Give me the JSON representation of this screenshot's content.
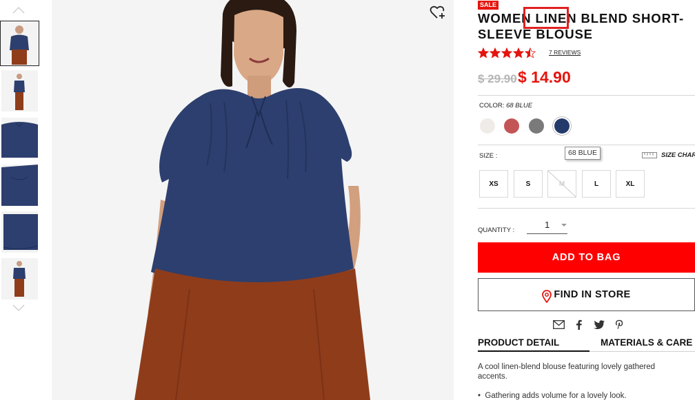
{
  "product": {
    "sale_badge": "SALE",
    "title": "WOMEN LINEN BLEND SHORT-SLEEVE BLOUSE",
    "rating": 4.5,
    "rating_max": 5,
    "reviews_label": "7 REVIEWS",
    "price_old": "$ 29.90",
    "price_new": "$ 14.90"
  },
  "color": {
    "label": "COLOR:",
    "selected_value": "68 BLUE",
    "swatches": [
      {
        "name": "off-white",
        "hex": "#efebe6"
      },
      {
        "name": "red",
        "hex": "#c45556"
      },
      {
        "name": "gray",
        "hex": "#7a7a7a"
      },
      {
        "name": "blue",
        "hex": "#243a6b"
      }
    ],
    "tooltip": "68 BLUE"
  },
  "size": {
    "label": "SIZE :",
    "chart_label": "SIZE CHART",
    "options": [
      "XS",
      "S",
      "M",
      "L",
      "XL"
    ],
    "unavailable": [
      "M"
    ]
  },
  "quantity": {
    "label": "QUANTITY :",
    "value": "1"
  },
  "actions": {
    "add_to_bag": "ADD TO BAG",
    "find_in_store": "FIND IN STORE"
  },
  "share": [
    "mail-icon",
    "facebook-icon",
    "twitter-icon",
    "pinterest-icon"
  ],
  "tabs": {
    "product_detail": "PRODUCT DETAIL",
    "materials": "MATERIALS & CARE"
  },
  "detail": {
    "description": "A cool linen-blend blouse featuring lovely gathered accents.",
    "bullet": "Gathering adds volume for a lovely look."
  },
  "colors": {
    "accent_red": "#ff0000",
    "sale_red": "#e4150e",
    "blouse_navy": "#2d3f6e",
    "skirt_rust": "#8f3c1b"
  }
}
